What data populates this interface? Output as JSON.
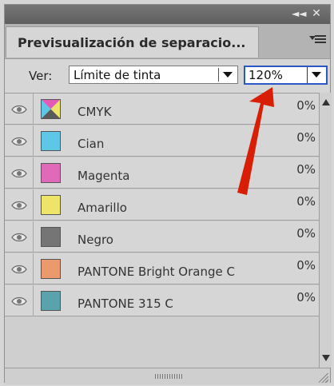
{
  "panel": {
    "title": "Previsualización de separacio...",
    "collapse_glyph": "◄◄",
    "close_glyph": "✕"
  },
  "view": {
    "label": "Ver:",
    "mode": "Límite de tinta",
    "ink_limit": "120%"
  },
  "colors": {
    "accent_focus": "#2a58c6",
    "annotation_arrow": "#d81e05"
  },
  "separations": [
    {
      "name": "CMYK",
      "percent": "0%",
      "swatch": "cmyk"
    },
    {
      "name": "Cian",
      "percent": "0%",
      "swatch": "#5ec7e6"
    },
    {
      "name": "Magenta",
      "percent": "0%",
      "swatch": "#e06aba"
    },
    {
      "name": "Amarillo",
      "percent": "0%",
      "swatch": "#ece56a"
    },
    {
      "name": "Negro",
      "percent": "0%",
      "swatch": "#757575"
    },
    {
      "name": "PANTONE Bright Orange C",
      "percent": "0%",
      "swatch": "#ea9a6d"
    },
    {
      "name": "PANTONE 315 C",
      "percent": "0%",
      "swatch": "#5aa3ac"
    }
  ],
  "icons": {
    "visibility": "eye-icon",
    "menu": "panel-menu-icon",
    "scroll_up": "scroll-up-icon",
    "scroll_down": "scroll-down-icon"
  }
}
